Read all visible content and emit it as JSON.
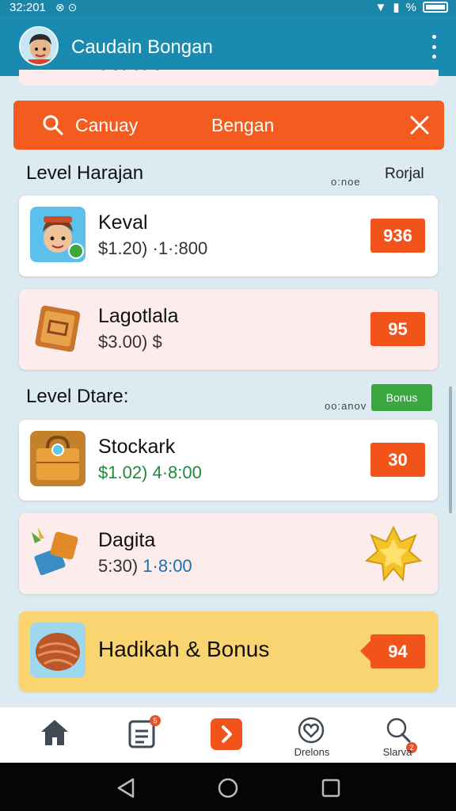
{
  "status_bar": {
    "time": "32:201",
    "battery_text": "%"
  },
  "app_bar": {
    "title": "Caudain Bongan"
  },
  "search": {
    "query": "Canuay",
    "query2": "Bengan"
  },
  "sections": [
    {
      "title": "Level Harajan",
      "meta": "o:noe",
      "right": "Rorjal"
    },
    {
      "title": "Level Dtare:",
      "meta": "oo:anov",
      "badge": "Bonus"
    }
  ],
  "cards": [
    {
      "name": "Keval",
      "sub": "$1.20) ·1·:800",
      "price": "936",
      "icon": "boy-avatar-icon"
    },
    {
      "name": "Lagotlala",
      "sub": "$3.00) $",
      "price": "95",
      "icon": "book-icon"
    },
    {
      "name": "Stockark",
      "sub": "$1.02) 4·8:00",
      "price": "30",
      "icon": "treasure-chest-icon"
    },
    {
      "name": "Dagita",
      "sub_a": "5:30)",
      "sub_b": "1·8:00",
      "icon": "game-items-icon",
      "badge_icon": "gold-star-icon"
    },
    {
      "name": "Hadikah & Bonus",
      "price": "94",
      "icon": "cookie-icon"
    }
  ],
  "bottom_nav": [
    {
      "label": "",
      "icon": "home-icon"
    },
    {
      "label": "",
      "icon": "list-icon",
      "badge": "5"
    },
    {
      "label": "",
      "icon": "play-icon"
    },
    {
      "label": "Drelons",
      "icon": "heart-icon"
    },
    {
      "label": "Slarva",
      "icon": "search-icon",
      "badge": "2"
    }
  ],
  "colors": {
    "primary": "#1a8bb0",
    "accent": "#f45b1f",
    "bonus": "#3aa83f",
    "highlight_card": "#f9d470"
  }
}
